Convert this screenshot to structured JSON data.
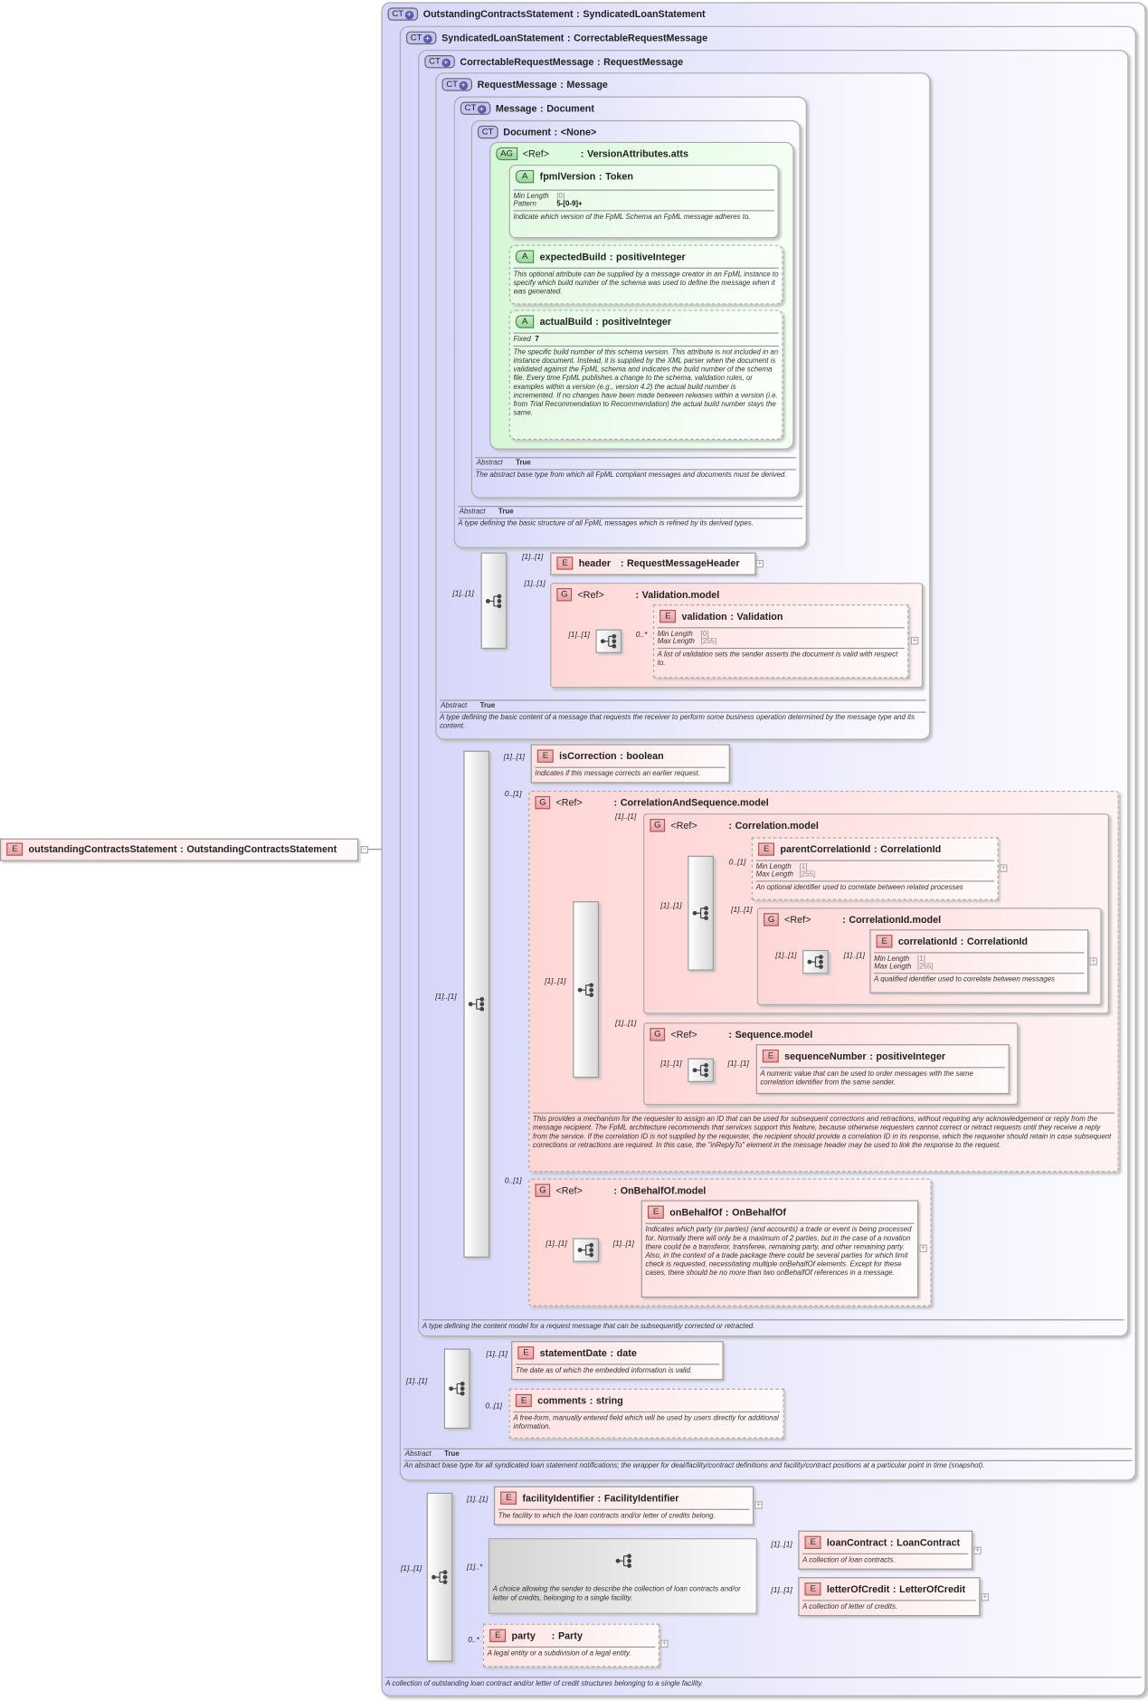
{
  "root": {
    "badge": "E",
    "name": "outstandingContractsStatement",
    "type": "OutstandingContractsStatement",
    "expand": "−"
  },
  "sep": ":",
  "types": [
    {
      "badge": "CT",
      "name": "OutstandingContractsStatement",
      "base": "SyndicatedLoanStatement",
      "description": "A collection of outstanding loan contract and/or letter of credit structures belonging to a single facility."
    },
    {
      "badge": "CT",
      "name": "SyndicatedLoanStatement",
      "base": "CorrectableRequestMessage",
      "abstract_label": "Abstract",
      "abstract_value": "True",
      "description": "An abstract base type for all syndicated loan statement notifications; the wrapper for deal/facility/contract definitions and facility/contract positions at a particular point in time (snapshot)."
    },
    {
      "badge": "CT",
      "name": "CorrectableRequestMessage",
      "base": "RequestMessage",
      "description": "A type defining the content model for a request message that can be subsequently corrected or retracted."
    },
    {
      "badge": "CT",
      "name": "RequestMessage",
      "base": "Message",
      "abstract_label": "Abstract",
      "abstract_value": "True",
      "description": "A type defining the basic content of a message that requests the receiver to perform some business operation determined by the message type and its content."
    },
    {
      "badge": "CT",
      "name": "Message",
      "base": "Document",
      "abstract_label": "Abstract",
      "abstract_value": "True",
      "description": "A type defining the basic structure of all FpML messages which is refined by its derived types."
    },
    {
      "badge": "CT",
      "name": "Document",
      "base": "<None>",
      "abstract_label": "Abstract",
      "abstract_value": "True",
      "description": "The abstract base type from which all FpML compliant messages and documents must be derived."
    }
  ],
  "attribute_group": {
    "badge": "AG",
    "ref": "<Ref>",
    "name": "VersionAttributes.atts",
    "attributes": [
      {
        "badge": "A",
        "name": "fpmlVersion",
        "type": "Token",
        "facets": [
          {
            "k": "Min Length",
            "v": "[0]"
          },
          {
            "k": "Pattern",
            "v": "5-[0-9]+"
          }
        ],
        "description": "Indicate which version of the FpML Schema an FpML message adheres to."
      },
      {
        "badge": "A",
        "name": "expectedBuild",
        "type": "positiveInteger",
        "description": "This optional attribute can be supplied by a message creator in an FpML instance to specify which build number of the schema was used to define the message when it was generated."
      },
      {
        "badge": "A",
        "name": "actualBuild",
        "type": "positiveInteger",
        "facets": [
          {
            "k": "Fixed",
            "v": "7"
          }
        ],
        "description": "The specific build number of this schema version. This attribute is not included in an instance document. Instead, it is supplied by the XML parser when the document is validated against the FpML schema and indicates the build number of the schema file. Every time FpML publishes a change to the schema, validation rules, or examples within a version (e.g., version 4.2) the actual build number is incremented. If no changes have been made between releases within a version (i.e. from Trial Recommendation to Recommendation) the actual build number stays the same."
      }
    ]
  },
  "request_message": {
    "seq_card": "[1]..[1]",
    "header": {
      "card": "[1]..[1]",
      "badge": "E",
      "name": "header",
      "type": "RequestMessageHeader"
    },
    "validation_model": {
      "card": "[1]..[1]",
      "badge": "G",
      "ref": "<Ref>",
      "name": "Validation.model",
      "seq_card": "[1]..[1]",
      "validation": {
        "card": "0..*",
        "badge": "E",
        "name": "validation",
        "type": "Validation",
        "facets": [
          {
            "k": "Min Length",
            "v": "[0]"
          },
          {
            "k": "Max Length",
            "v": "[255]"
          }
        ],
        "description": "A list of validation sets the sender asserts the document is valid with respect to."
      }
    }
  },
  "correctable": {
    "seq_card": "[1]..[1]",
    "isCorrection": {
      "card": "[1]..[1]",
      "badge": "E",
      "name": "isCorrection",
      "type": "boolean",
      "description": "Indicates if this message corrects an earlier request."
    },
    "correlation_and_sequence": {
      "card": "0..[1]",
      "badge": "G",
      "ref": "<Ref>",
      "name": "CorrelationAndSequence.model",
      "seq_card": "[1]..[1]",
      "description": "This provides a mechanism for the requester to assign an ID that can be used for subsequent corrections and retractions, without requiring any acknowledgement or reply from the message recipient. The FpML architecture recommends that services support this feature, because otherwise requesters cannot correct or retract requests until they receive a reply from the service. If the correlation ID is not supplied by the requester, the recipient should provide a correlation ID in its response, which the requester should retain in case subsequent corrections or retractions are required. In this case, the \"inReplyTo\" element in the message header may be used to link the response to the request.",
      "correlation_model": {
        "card": "[1]..[1]",
        "badge": "G",
        "ref": "<Ref>",
        "name": "Correlation.model",
        "seq_card": "[1]..[1]",
        "parentCorrelationId": {
          "card": "0..[1]",
          "badge": "E",
          "name": "parentCorrelationId",
          "type": "CorrelationId",
          "facets": [
            {
              "k": "Min Length",
              "v": "[1]"
            },
            {
              "k": "Max Length",
              "v": "[255]"
            }
          ],
          "description": "An optional identifier used to correlate between related processes"
        },
        "correlationId_model": {
          "card": "[1]..[1]",
          "badge": "G",
          "ref": "<Ref>",
          "name": "CorrelationId.model",
          "seq_card": "[1]..[1]",
          "correlationId": {
            "card": "[1]..[1]",
            "badge": "E",
            "name": "correlationId",
            "type": "CorrelationId",
            "facets": [
              {
                "k": "Min Length",
                "v": "[1]"
              },
              {
                "k": "Max Length",
                "v": "[255]"
              }
            ],
            "description": "A qualified identifier used to correlate between messages"
          }
        }
      },
      "sequence_model": {
        "card": "[1]..[1]",
        "badge": "G",
        "ref": "<Ref>",
        "name": "Sequence.model",
        "seq_card": "[1]..[1]",
        "sequenceNumber": {
          "card": "[1]..[1]",
          "badge": "E",
          "name": "sequenceNumber",
          "type": "positiveInteger",
          "description": "A numeric value that can be used to order messages with the same correlation identifier from the same sender."
        }
      }
    },
    "onBehalfOf_model": {
      "card": "0..[1]",
      "badge": "G",
      "ref": "<Ref>",
      "name": "OnBehalfOf.model",
      "seq_card": "[1]..[1]",
      "onBehalfOf": {
        "card": "[1]..[1]",
        "badge": "E",
        "name": "onBehalfOf",
        "type": "OnBehalfOf",
        "description": "Indicates which party (or parties) (and accounts) a trade or event is being processed for. Normally there will only be a maximum of 2 parties, but in the case of a novation there could be a transferor, transferee, remaining party, and other remaining party. Also, in the context of a trade package there could be several parties for which limit check is requested, necessitating multiple onBehalfOf elements. Except for these cases, there should be no more than two onBehalfOf references in a message."
      }
    }
  },
  "syndicated": {
    "seq_card": "[1]..[1]",
    "statementDate": {
      "card": "[1]..[1]",
      "badge": "E",
      "name": "statementDate",
      "type": "date",
      "description": "The date as of which the embedded information is valid."
    },
    "comments": {
      "card": "0..[1]",
      "badge": "E",
      "name": "comments",
      "type": "string",
      "description": "A free-form, manually entered field which will be used by users directly for additional information."
    }
  },
  "outstanding": {
    "seq_card": "[1]..[1]",
    "facilityIdentifier": {
      "card": "[1]..[1]",
      "badge": "E",
      "name": "facilityIdentifier",
      "type": "FacilityIdentifier",
      "description": "The facility to which the loan contracts and/or letter of credits belong."
    },
    "choice": {
      "card": "[1]..*",
      "description": "A choice allowing the sender to describe the collection of loan contracts and/or letter of credits, belonging to a single facility.",
      "loanContract": {
        "card": "[1]..[1]",
        "badge": "E",
        "name": "loanContract",
        "type": "LoanContract",
        "description": "A collection of loan contracts."
      },
      "letterOfCredit": {
        "card": "[1]..[1]",
        "badge": "E",
        "name": "letterOfCredit",
        "type": "LetterOfCredit",
        "description": "A collection of letter of credits."
      }
    },
    "party": {
      "card": "0..*",
      "badge": "E",
      "name": "party",
      "type": "Party",
      "description": "A legal entity or a subdivision of a legal entity."
    }
  },
  "colors": {
    "complex_type": "#d6d6fa",
    "attribute_group": "#d6f8d6",
    "group": "#ffd6d6",
    "element": "#ffe2e2"
  }
}
